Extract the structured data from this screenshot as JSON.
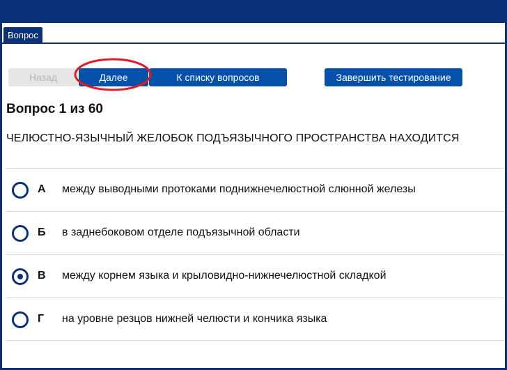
{
  "tabs": {
    "active_label": "Вопрос"
  },
  "toolbar": {
    "back_label": "Назад",
    "next_label": "Далее",
    "list_label": "К списку вопросов",
    "finish_label": "Завершить тестирование"
  },
  "question": {
    "title": "Вопрос 1 из 60",
    "text": "ЧЕЛЮСТНО-ЯЗЫЧНЫЙ ЖЕЛОБОК ПОДЪЯЗЫЧНОГО ПРОСТРАНСТВА НАХОДИТСЯ"
  },
  "options": [
    {
      "letter": "А",
      "text": "между выводными протоками поднижнечелюстной слюнной железы",
      "selected": false
    },
    {
      "letter": "Б",
      "text": "в заднебоковом отделе подъязычной области",
      "selected": false
    },
    {
      "letter": "В",
      "text": "между корнем языка и крыловидно-нижнечелюстной складкой",
      "selected": true
    },
    {
      "letter": "Г",
      "text": "на уровне резцов нижней челюсти и кончика языка",
      "selected": false
    }
  ],
  "colors": {
    "header": "#0b3178",
    "button": "#0550a8",
    "button_disabled": "#e6e6e6",
    "highlight": "#e01b24"
  }
}
